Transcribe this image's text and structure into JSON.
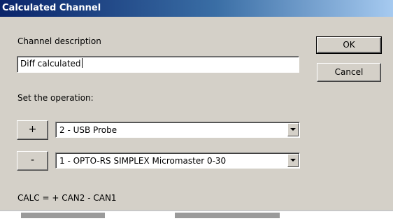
{
  "window": {
    "title": "Calculated Channel"
  },
  "description": {
    "label": "Channel description",
    "value": "Diff calculated"
  },
  "buttons": {
    "ok_label": "OK",
    "cancel_label": "Cancel"
  },
  "operation": {
    "label": "Set the operation:",
    "rows": [
      {
        "sign_label": "+",
        "selected": "2 - USB Probe"
      },
      {
        "sign_label": "-",
        "selected": "1 - OPTO-RS SIMPLEX Micromaster 0-30"
      }
    ]
  },
  "formula": "CALC = + CAN2 - CAN1",
  "colors": {
    "title_gradient_start": "#0a246a",
    "title_gradient_end": "#a6caf0",
    "dialog_background": "#d4d0c8",
    "field_background": "#ffffff"
  }
}
